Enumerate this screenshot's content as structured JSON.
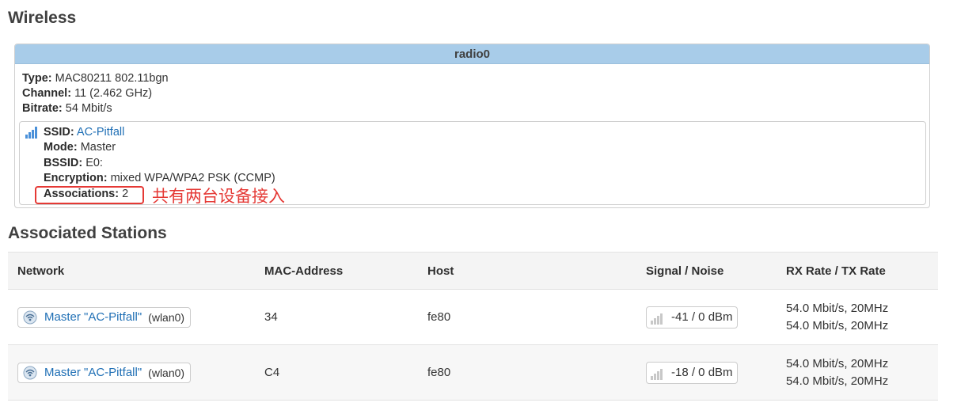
{
  "wireless_title": "Wireless",
  "radio": {
    "header": "radio0",
    "type_label": "Type:",
    "type_value": "MAC80211 802.11bgn",
    "channel_label": "Channel:",
    "channel_value": "11 (2.462 GHz)",
    "bitrate_label": "Bitrate:",
    "bitrate_value": "54 Mbit/s",
    "network": {
      "ssid_label": "SSID:",
      "ssid_value": "AC-Pitfall",
      "mode_label": "Mode:",
      "mode_value": "Master",
      "bssid_label": "BSSID:",
      "bssid_value": "E0:",
      "encryption_label": "Encryption:",
      "encryption_value": "mixed WPA/WPA2 PSK (CCMP)",
      "associations_label": "Associations:",
      "associations_value": "2",
      "annotation": "共有两台设备接入",
      "signal_icon": "signal-bars-icon"
    }
  },
  "stations_title": "Associated Stations",
  "stations": {
    "columns": [
      "Network",
      "MAC-Address",
      "Host",
      "Signal / Noise",
      "RX Rate / TX Rate"
    ],
    "rows": [
      {
        "network": "Master \"AC-Pitfall\"",
        "iface": "(wlan0)",
        "mac": "34",
        "host": "fe80",
        "signal": "-41 / 0 dBm",
        "rx_rate": "54.0 Mbit/s, 20MHz",
        "tx_rate": "54.0 Mbit/s, 20MHz"
      },
      {
        "network": "Master \"AC-Pitfall\"",
        "iface": "(wlan0)",
        "mac": "C4",
        "host": "fe80",
        "signal": "-18 / 0 dBm",
        "rx_rate": "54.0 Mbit/s, 20MHz",
        "tx_rate": "54.0 Mbit/s, 20MHz"
      }
    ]
  },
  "colors": {
    "header_bg": "#a8cce9",
    "link": "#1f6fb5",
    "annotation": "#e53935"
  }
}
